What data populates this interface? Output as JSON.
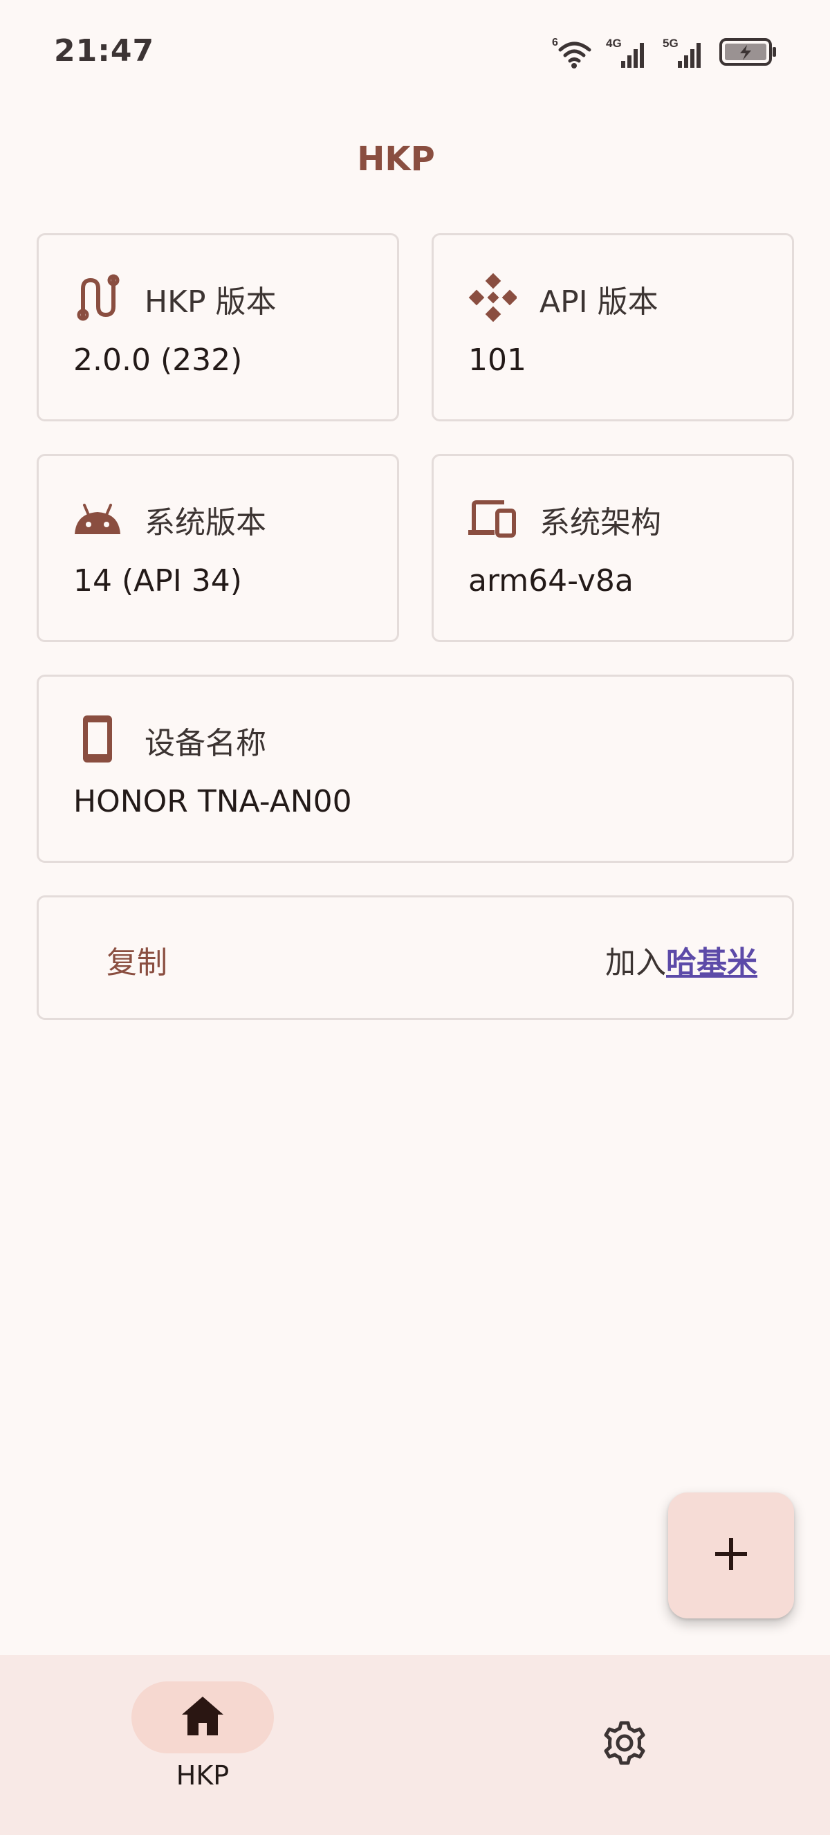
{
  "status_bar": {
    "time": "21:47",
    "icons": [
      "wifi-6-icon",
      "signal-4g-icon",
      "signal-5g-icon",
      "battery-charging-icon"
    ],
    "wifi_tag": "6",
    "net_4g": "4G",
    "net_5g": "5G"
  },
  "app": {
    "title": "HKP"
  },
  "cards": {
    "hkp_version": {
      "label": "HKP 版本",
      "value": "2.0.0 (232)",
      "icon": "route-icon"
    },
    "api_version": {
      "label": "API 版本",
      "value": "101",
      "icon": "diamond-grid-icon"
    },
    "system_version": {
      "label": "系统版本",
      "value": "14 (API 34)",
      "icon": "android-icon"
    },
    "system_arch": {
      "label": "系统架构",
      "value": "arm64-v8a",
      "icon": "devices-icon"
    },
    "device_name": {
      "label": "设备名称",
      "value": "HONOR TNA-AN00",
      "icon": "phone-icon"
    }
  },
  "actions": {
    "copy_label": "复制",
    "join_prefix": "加入",
    "join_link": "哈基米"
  },
  "fab": {
    "icon": "plus-icon"
  },
  "bottom_nav": {
    "items": [
      {
        "label": "HKP",
        "icon": "home-icon",
        "selected": true
      },
      {
        "label": "",
        "icon": "gear-icon",
        "selected": false
      }
    ]
  },
  "colors": {
    "background": "#fdf8f6",
    "accent": "#8a4e40",
    "link": "#5c4aa8",
    "card_border": "#e4dcda",
    "fab_bg": "#f6dcd6",
    "nav_bg": "#f8e9e6",
    "nav_pill": "#f6d8d0"
  }
}
